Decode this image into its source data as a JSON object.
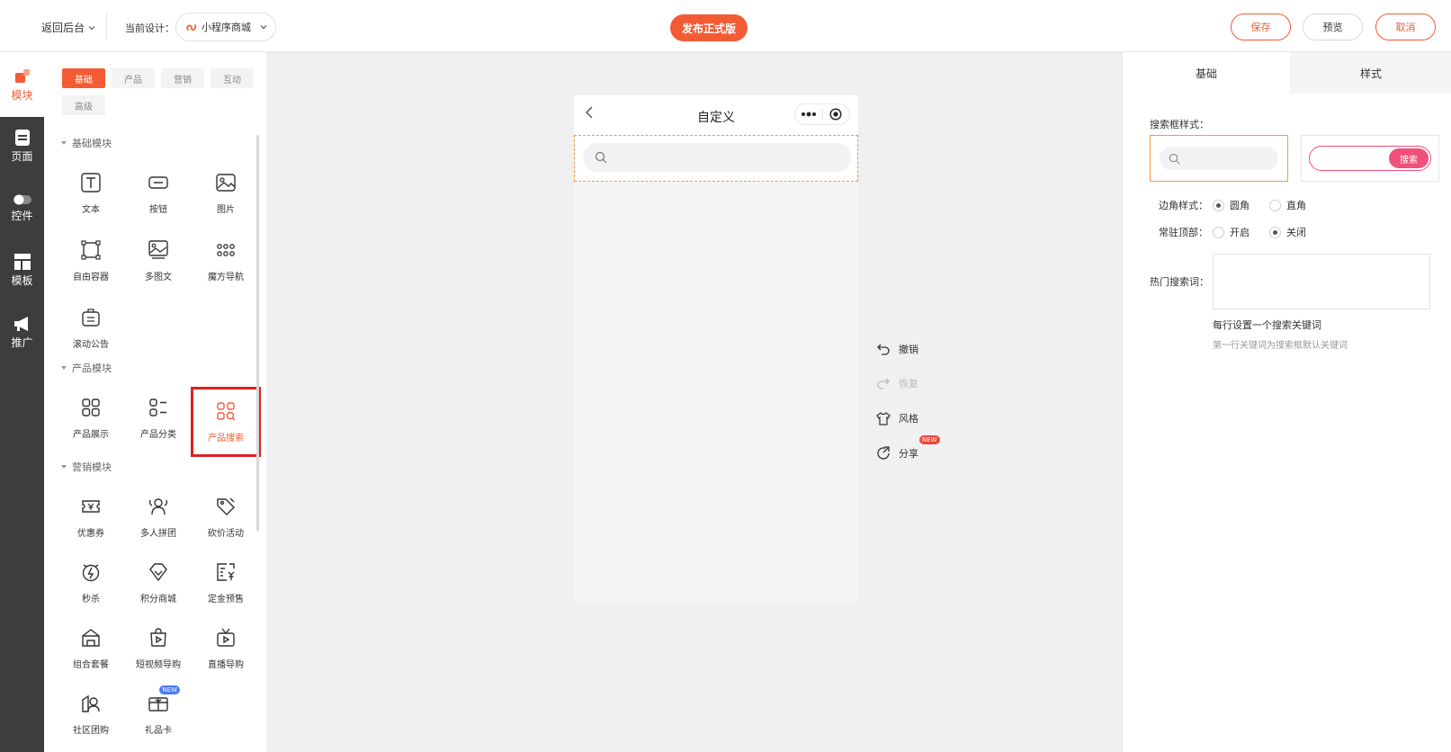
{
  "header": {
    "back_label": "返回后台",
    "design_label": "当前设计：",
    "design_value": "小程序商城",
    "publish_label": "发布正式版",
    "save_label": "保存",
    "preview_label": "预览",
    "cancel_label": "取消"
  },
  "rail": {
    "items": [
      {
        "label": "模块"
      },
      {
        "label": "页面"
      },
      {
        "label": "控件"
      },
      {
        "label": "模板"
      },
      {
        "label": "推广"
      }
    ]
  },
  "panel": {
    "tabs": [
      {
        "label": "基础"
      },
      {
        "label": "产品"
      },
      {
        "label": "营销"
      },
      {
        "label": "互动"
      },
      {
        "label": "高级"
      }
    ],
    "sections": {
      "basic": {
        "title": "基础模块",
        "items": [
          {
            "label": "文本",
            "icon": "text-icon"
          },
          {
            "label": "按钮",
            "icon": "button-icon"
          },
          {
            "label": "图片",
            "icon": "image-icon"
          },
          {
            "label": "自由容器",
            "icon": "container-icon"
          },
          {
            "label": "多图文",
            "icon": "multi-image-icon"
          },
          {
            "label": "魔方导航",
            "icon": "grid-dots-icon"
          },
          {
            "label": "滚动公告",
            "icon": "notice-icon"
          }
        ]
      },
      "product": {
        "title": "产品模块",
        "items": [
          {
            "label": "产品展示",
            "icon": "grid-icon"
          },
          {
            "label": "产品分类",
            "icon": "category-icon"
          },
          {
            "label": "产品搜索",
            "icon": "product-search-icon"
          }
        ]
      },
      "marketing": {
        "title": "营销模块",
        "items": [
          {
            "label": "优惠券",
            "icon": "coupon-icon"
          },
          {
            "label": "多人拼团",
            "icon": "group-buy-icon"
          },
          {
            "label": "砍价活动",
            "icon": "bargain-icon"
          },
          {
            "label": "秒杀",
            "icon": "flash-sale-icon"
          },
          {
            "label": "积分商城",
            "icon": "diamond-icon"
          },
          {
            "label": "定金预售",
            "icon": "presale-icon"
          },
          {
            "label": "组合套餐",
            "icon": "combo-icon"
          },
          {
            "label": "短视频导购",
            "icon": "video-bag-icon"
          },
          {
            "label": "直播导购",
            "icon": "live-tv-icon"
          },
          {
            "label": "社区团购",
            "icon": "community-icon"
          },
          {
            "label": "礼品卡",
            "icon": "gift-card-icon",
            "badge": "NEW"
          }
        ]
      }
    }
  },
  "canvas": {
    "page_title": "自定义"
  },
  "tools": [
    {
      "label": "撤销"
    },
    {
      "label": "恢复"
    },
    {
      "label": "风格"
    },
    {
      "label": "分享",
      "badge": "NEW"
    }
  ],
  "settings": {
    "tabs": [
      {
        "label": "基础"
      },
      {
        "label": "样式"
      }
    ],
    "search_style_label": "搜索框样式：",
    "search_button_label": "搜索",
    "corner_label": "边角样式：",
    "corner_options": [
      "圆角",
      "直角"
    ],
    "sticky_label": "常驻顶部：",
    "sticky_options": [
      "开启",
      "关闭"
    ],
    "hot_label": "热门搜索词：",
    "hot_value": "",
    "hint_1": "每行设置一个搜索关键词",
    "hint_2": "第一行关键词为搜索框默认关键词"
  },
  "colors": {
    "accent": "#f35b34",
    "rail_bg": "#3d3d3d",
    "highlight_box": "#e02020",
    "search_button": "#f0507a"
  }
}
